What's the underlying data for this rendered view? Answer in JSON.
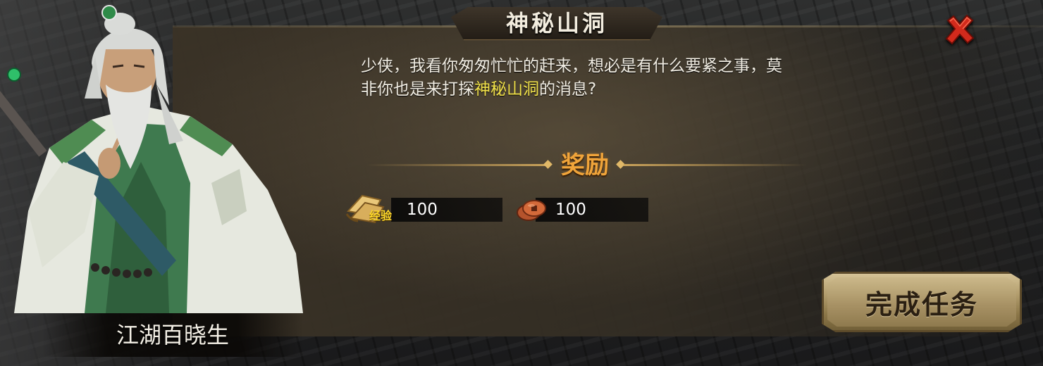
{
  "dialog": {
    "title": "神秘山洞",
    "npc_name": "江湖百晓生",
    "text_line1": "少侠，我看你匆匆忙忙的赶来，想必是有什么要紧之事，莫",
    "text_line2_pre": "非你也是来打探",
    "text_line2_highlight": "神秘山洞",
    "text_line2_post": "的消息?",
    "highlight_color": "#f2e24a"
  },
  "rewards": {
    "title": "奖励",
    "items": [
      {
        "icon": "experience-scroll-icon",
        "label": "经验",
        "value": "100"
      },
      {
        "icon": "copper-coin-icon",
        "value": "100"
      }
    ]
  },
  "buttons": {
    "complete_label": "完成任务",
    "close_icon": "close-x-icon"
  }
}
